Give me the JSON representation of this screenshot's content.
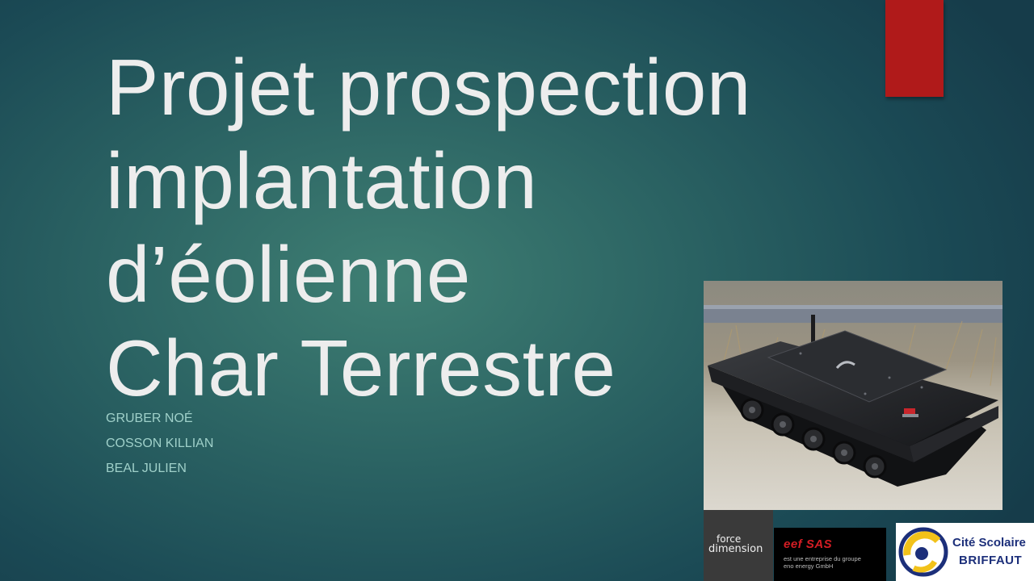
{
  "slide": {
    "title_lines": [
      "Projet prospection",
      "implantation",
      "d’éolienne",
      "Char Terrestre"
    ],
    "authors": [
      "GRUBER NOÉ",
      "COSSON KILLIAN",
      "BEAL JULIEN"
    ]
  },
  "logos": {
    "force_dimension": {
      "line1": "force",
      "line2": "dimension"
    },
    "eef": {
      "brand": "eef SAS",
      "subtitle_line1": "est une entreprise du groupe",
      "subtitle_line2": "eno energy GmbH"
    },
    "cite_scolaire": {
      "line1": "Cité Scolaire",
      "line2": "BRIFFAUT"
    }
  },
  "colors": {
    "accent": "#b01a1a",
    "title": "#ededed",
    "authors": "#9fd0c9"
  }
}
